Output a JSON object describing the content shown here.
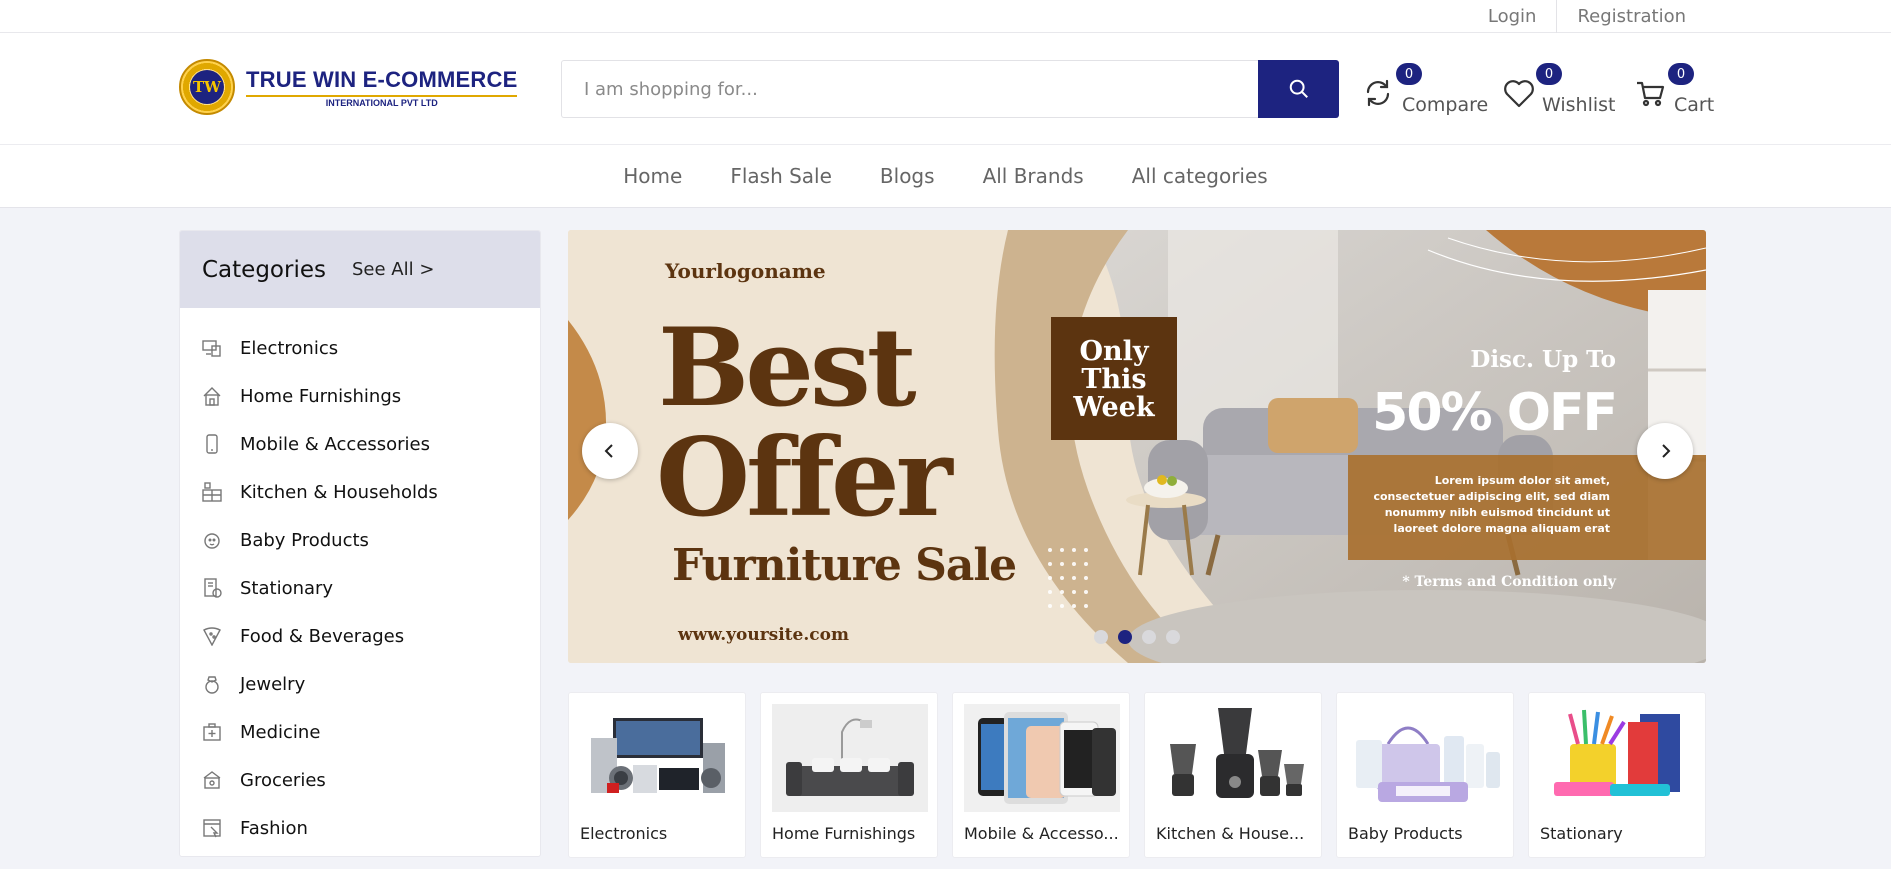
{
  "topbar": {
    "login": "Login",
    "registration": "Registration"
  },
  "brand": {
    "name": "TRUE WIN E-COMMERCE",
    "sub": "INTERNATIONAL PVT LTD",
    "seal_letters": "TW"
  },
  "search": {
    "placeholder": "I am shopping for..."
  },
  "header_actions": {
    "compare": {
      "label": "Compare",
      "count": "0",
      "icon": "refresh-icon"
    },
    "wishlist": {
      "label": "Wishlist",
      "count": "0",
      "icon": "heart-icon"
    },
    "cart": {
      "label": "Cart",
      "count": "0",
      "icon": "cart-icon"
    }
  },
  "nav": [
    "Home",
    "Flash Sale",
    "Blogs",
    "All Brands",
    "All categories"
  ],
  "categories": {
    "title": "Categories",
    "see_all": "See All >",
    "items": [
      {
        "label": "Electronics",
        "icon": "devices-icon"
      },
      {
        "label": "Home Furnishings",
        "icon": "home-icon"
      },
      {
        "label": "Mobile & Accessories",
        "icon": "phone-icon"
      },
      {
        "label": "Kitchen & Households",
        "icon": "kitchen-icon"
      },
      {
        "label": "Baby Products",
        "icon": "baby-icon"
      },
      {
        "label": "Stationary",
        "icon": "stationary-icon"
      },
      {
        "label": "Food & Beverages",
        "icon": "pizza-icon"
      },
      {
        "label": "Jewelry",
        "icon": "ring-icon"
      },
      {
        "label": "Medicine",
        "icon": "medkit-icon"
      },
      {
        "label": "Groceries",
        "icon": "basket-icon"
      },
      {
        "label": "Fashion",
        "icon": "fashion-icon"
      }
    ]
  },
  "banner": {
    "logo": "Yourlogoname",
    "headline1": "Best",
    "headline2": "Offer",
    "subline": "Furniture Sale",
    "site": "www.yoursite.com",
    "badge": [
      "Only",
      "This",
      "Week"
    ],
    "disc_label": "Disc. Up To",
    "disc_value": "50% OFF",
    "lorem": [
      "Lorem ipsum dolor sit amet,",
      "consectetuer adipiscing elit, sed diam",
      "nonummy nibh euismod tincidunt ut",
      "laoreet dolore magna aliquam erat"
    ],
    "terms": "* Terms and Condition only",
    "active_slide": 2,
    "slide_count": 4,
    "colors": {
      "brown": "#5c3410",
      "cream": "#efe4d3",
      "tan": "#cdb38f",
      "accent": "#1d2380"
    }
  },
  "tiles": [
    {
      "label": "Electronics"
    },
    {
      "label": "Home Furnishings"
    },
    {
      "label": "Mobile & Accesso..."
    },
    {
      "label": "Kitchen & House..."
    },
    {
      "label": "Baby Products"
    },
    {
      "label": "Stationary"
    }
  ],
  "colors": {
    "primary": "#1d2380",
    "background": "#f2f3f8"
  }
}
